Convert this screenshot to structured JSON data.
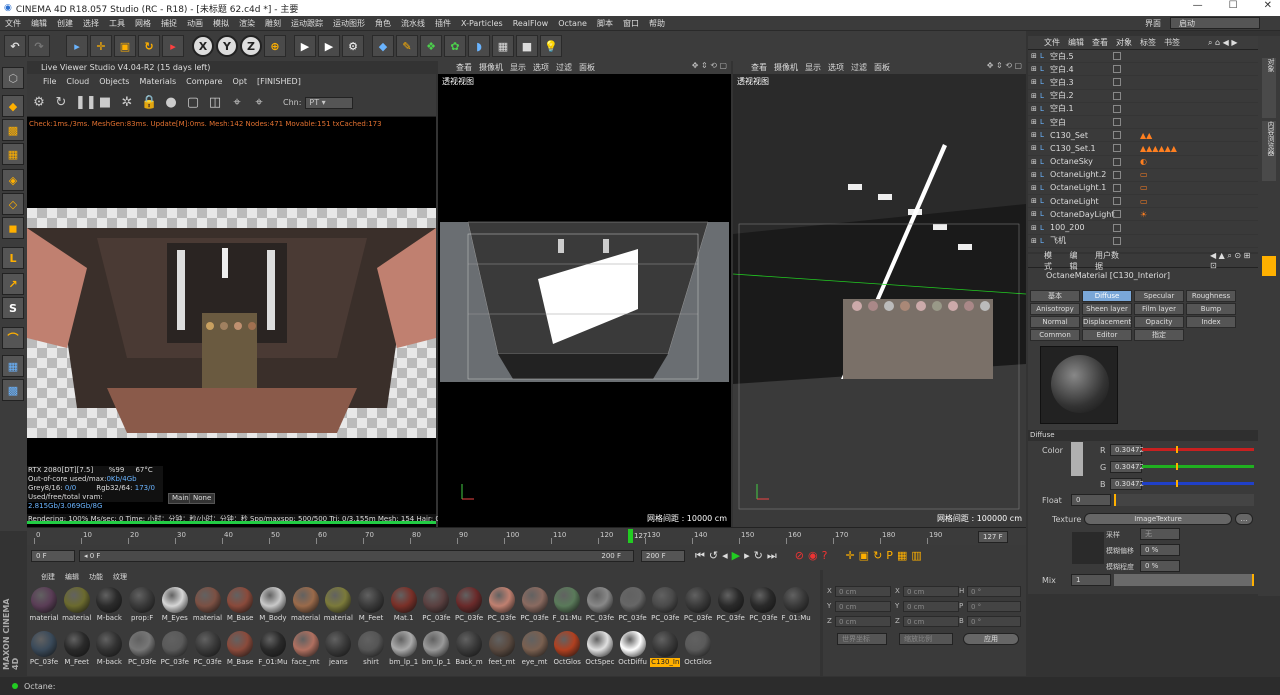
{
  "window": {
    "title": "CINEMA 4D R18.057 Studio (RC - R18) - [未标题 62.c4d *] - 主要",
    "controls": [
      "—",
      "☐",
      "✕"
    ]
  },
  "menu": [
    "文件",
    "编辑",
    "创建",
    "选择",
    "工具",
    "网格",
    "捕捉",
    "动画",
    "模拟",
    "渲染",
    "雕刻",
    "运动跟踪",
    "运动图形",
    "角色",
    "流水线",
    "插件",
    "X-Particles",
    "RealFlow",
    "Octane",
    "脚本",
    "窗口",
    "帮助"
  ],
  "layout": {
    "label": "界面",
    "value": "启动"
  },
  "toolbar": {
    "axis_x": "X",
    "axis_y": "Y",
    "axis_z": "Z"
  },
  "live_viewer": {
    "title": "Live Viewer Studio V4.04-R2 (15 days left)",
    "menu": [
      "File",
      "Cloud",
      "Objects",
      "Materials",
      "Compare",
      "Opt",
      "[FINISHED]"
    ],
    "channel_label": "Chn:",
    "channel_value": "PT",
    "status_line": "Check:1ms./3ms. MeshGen:83ms. Update[M]:0ms. Mesh:142 Nodes:471 Movable:151 txCached:173",
    "gpu": "RTX 2080[DT][7.5]",
    "gpu_pct": "%99",
    "gpu_temp": "67°C",
    "out_of_core_label": "Out-of-core used/max:",
    "out_of_core_value": "0Kb/4Gb",
    "grey_label": "Grey8/16:",
    "grey_value": "0/0",
    "rgb_label": "Rgb32/64:",
    "rgb_value": "173/0",
    "vram_label": "Used/free/total vram:",
    "vram_value": "2.815Gb/3.069Gb/8G",
    "btn_main": "Main",
    "btn_none": "None",
    "render_line": "Rendering: 100%   Ms/sec: 0   Time: 小时：分钟：秒/小时：分钟：秒   Spp/maxspp: 500/500     Tri: 0/3.155m  Mesh: 154  Hair: 0",
    "render_progress": 100
  },
  "viewport_menu": [
    "查看",
    "摄像机",
    "显示",
    "选项",
    "过滤",
    "面板"
  ],
  "viewport_mid": {
    "label": "透视视图",
    "scale": "网格间距 : 10000 cm"
  },
  "viewport_right": {
    "label": "透视视图",
    "scale": "网格间距 : 100000 cm"
  },
  "object_manager": {
    "tabs": [
      "文件",
      "编辑",
      "查看",
      "对象",
      "标签",
      "书签"
    ],
    "items": [
      {
        "name": "空白.5",
        "tags": ""
      },
      {
        "name": "空白.4",
        "tags": ""
      },
      {
        "name": "空白.3",
        "tags": ""
      },
      {
        "name": "空白.2",
        "tags": ""
      },
      {
        "name": "空白.1",
        "tags": ""
      },
      {
        "name": "空白",
        "tags": ""
      },
      {
        "name": "C130_Set",
        "tags": "▲▲"
      },
      {
        "name": "C130_Set.1",
        "tags": "▲▲▲▲▲▲"
      },
      {
        "name": "OctaneSky",
        "tags": "◐"
      },
      {
        "name": "OctaneLight.2",
        "tags": "▭"
      },
      {
        "name": "OctaneLight.1",
        "tags": "▭"
      },
      {
        "name": "OctaneLight",
        "tags": "▭"
      },
      {
        "name": "OctaneDayLight",
        "tags": "☀"
      },
      {
        "name": "100_200",
        "tags": ""
      },
      {
        "name": "飞机",
        "tags": ""
      }
    ]
  },
  "attribute_manager": {
    "tabs": [
      "模式",
      "编辑",
      "用户数据"
    ],
    "title": "OctaneMaterial [C130_Interior]",
    "prop_tabs": [
      "基本",
      "Diffuse",
      "Specular",
      "Roughness",
      "Anisotropy",
      "Sheen layer",
      "Film layer",
      "Bump",
      "Normal",
      "Displacement",
      "Opacity",
      "Index",
      "Common",
      "Editor",
      "指定"
    ],
    "section": "Diffuse",
    "color_label": "Color",
    "r_label": "R",
    "r": "0.30472",
    "g_label": "G",
    "g": "0.30472",
    "b_label": "B",
    "b": "0.30472",
    "float_label": "Float",
    "float_value": "0",
    "texture_label": "Texture",
    "texture_value": "ImageTexture",
    "sample_label": "采样",
    "sample_value": "无",
    "blur_offset_label": "模糊偏移",
    "blur_offset": "0 %",
    "blur_scale_label": "模糊程度",
    "blur_scale": "0 %",
    "mix_label": "Mix",
    "mix_value": "1"
  },
  "timeline": {
    "ticks": [
      "0",
      "10",
      "20",
      "30",
      "40",
      "50",
      "60",
      "70",
      "80",
      "90",
      "100",
      "110",
      "120",
      "130",
      "140",
      "150",
      "160",
      "170",
      "180",
      "190"
    ],
    "marker": "127",
    "current_frame_right": "127 F",
    "start_field": "0 F",
    "min_field": "0 F",
    "end_field": "200 F",
    "max_field": "200 F"
  },
  "material_manager": {
    "menu": [
      "创建",
      "编辑",
      "功能",
      "纹理"
    ],
    "row1": [
      {
        "label": "material",
        "color": "#5a3d56"
      },
      {
        "label": "material",
        "color": "#6b6a2e"
      },
      {
        "label": "M-back",
        "color": "#2b2b2b"
      },
      {
        "label": "prop:F",
        "color": "#3a3a3a"
      },
      {
        "label": "M_Eyes",
        "color": "#d6d6d6"
      },
      {
        "label": "material",
        "color": "#7b5043"
      },
      {
        "label": "M_Base",
        "color": "#8a4a3b"
      },
      {
        "label": "M_Body",
        "color": "#c9c9c9"
      },
      {
        "label": "material",
        "color": "#9a6a4a"
      },
      {
        "label": "material",
        "color": "#7b7a3a"
      },
      {
        "label": "M_Feet",
        "color": "#3a3a3a"
      },
      {
        "label": "Mat.1",
        "color": "#7a3028"
      },
      {
        "label": "PC_03fe",
        "color": "#5a4040"
      },
      {
        "label": "PC_03fe",
        "color": "#6a2a2a"
      },
      {
        "label": "PC_03fe",
        "color": "#c08070"
      },
      {
        "label": "PC_03fe",
        "color": "#8a6a60"
      },
      {
        "label": "F_01:Mu",
        "color": "#5a7a5a"
      },
      {
        "label": "PC_03fe",
        "color": "#888888"
      },
      {
        "label": "PC_03fe",
        "color": "#666666"
      },
      {
        "label": "PC_03fe",
        "color": "#4a4a4a"
      },
      {
        "label": "PC_03fe",
        "color": "#3a3a3a"
      },
      {
        "label": "PC_03fe",
        "color": "#2a2a2a"
      },
      {
        "label": "PC_03fe",
        "color": "#2a2a2a"
      },
      {
        "label": "F_01:Mu",
        "color": "#3a3a3a"
      }
    ],
    "row2": [
      {
        "label": "PC_03fe",
        "color": "#3a4a5a"
      },
      {
        "label": "M_Feet",
        "color": "#2a2a2a"
      },
      {
        "label": "M-back",
        "color": "#333333"
      },
      {
        "label": "PC_03fe",
        "color": "#777777"
      },
      {
        "label": "PC_03fe",
        "color": "#5a5a5a"
      },
      {
        "label": "PC_03fe",
        "color": "#3a3a3a"
      },
      {
        "label": "M_Base",
        "color": "#8a4a3b"
      },
      {
        "label": "F_01:Mu",
        "color": "#2a2a2a"
      },
      {
        "label": "face_mt",
        "color": "#b07060"
      },
      {
        "label": "jeans",
        "color": "#3a3a3a"
      },
      {
        "label": "shirt",
        "color": "#555555"
      },
      {
        "label": "bm_lp_1",
        "color": "#aaaaaa"
      },
      {
        "label": "bm_lp_1",
        "color": "#999999"
      },
      {
        "label": "Back_m",
        "color": "#3a3a3a"
      },
      {
        "label": "feet_mt",
        "color": "#5a4a40"
      },
      {
        "label": "eye_mt",
        "color": "#7a6050"
      },
      {
        "label": "OctGlos",
        "color": "#b04020"
      },
      {
        "label": "OctSpec",
        "color": "#e0e0e0"
      },
      {
        "label": "OctDiffu",
        "color": "#ffffff"
      },
      {
        "label": "C130_In",
        "color": "#3a3a3a"
      },
      {
        "label": "OctGlos",
        "color": "#5a5a5a"
      }
    ],
    "selected": "C130_In"
  },
  "coords": {
    "rows": [
      {
        "axis": "X",
        "v1": "0 cm",
        "axis2": "X",
        "v2": "0 cm",
        "axis3": "H",
        "v3": "0 °"
      },
      {
        "axis": "Y",
        "v1": "0 cm",
        "axis2": "Y",
        "v2": "0 cm",
        "axis3": "P",
        "v3": "0 °"
      },
      {
        "axis": "Z",
        "v1": "0 cm",
        "axis2": "Z",
        "v2": "0 cm",
        "axis3": "B",
        "v3": "0 °"
      }
    ],
    "world": "世界坐标",
    "scale": "缩放比例",
    "apply": "应用"
  },
  "status": {
    "text": "Octane:"
  },
  "colors": {
    "accent": "#ffb000",
    "selected_tab": "#7aa7d8",
    "progress": "#22cc44"
  }
}
